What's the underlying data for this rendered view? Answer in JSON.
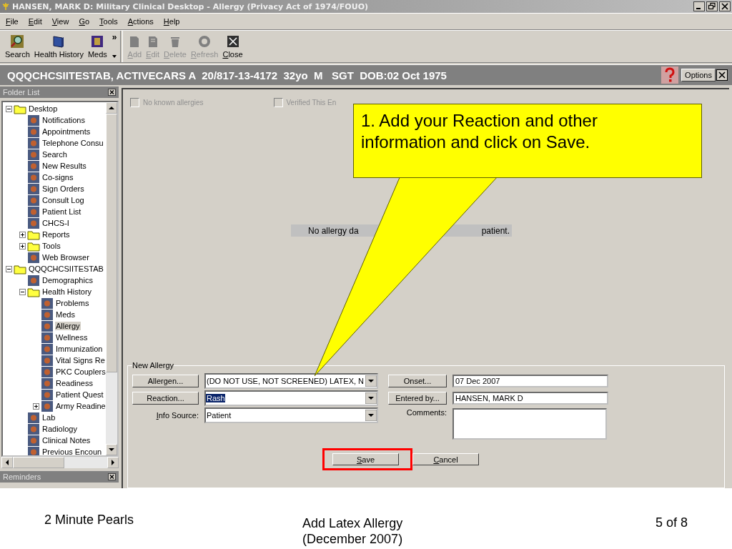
{
  "window": {
    "title": "HANSEN, MARK D: Military Clinical Desktop - Allergy (Privacy Act of 1974/FOUO)"
  },
  "menu": [
    "File",
    "Edit",
    "View",
    "Go",
    "Tools",
    "Actions",
    "Help"
  ],
  "toolbar": {
    "left": [
      {
        "label": "Search",
        "kind": "search",
        "disabled": false
      },
      {
        "label": "Health History",
        "kind": "book",
        "disabled": false
      },
      {
        "label": "Meds",
        "kind": "meds",
        "disabled": false
      }
    ],
    "more": "»",
    "right": [
      {
        "label": "Add",
        "kind": "doc",
        "disabled": true
      },
      {
        "label": "Edit",
        "kind": "edit",
        "disabled": true
      },
      {
        "label": "Delete",
        "kind": "trash",
        "disabled": true
      },
      {
        "label": "Refresh",
        "kind": "refresh",
        "disabled": true
      },
      {
        "label": "Close",
        "kind": "close",
        "disabled": false
      }
    ]
  },
  "patient_bar": {
    "text": "QQQCHCSIITESTAB, ACTIVECARS A  20/817-13-4172  32yo  M   SGT  DOB:02 Oct 1975",
    "options": "Options"
  },
  "folder_list": {
    "title": "Folder List",
    "tree": [
      {
        "label": "Desktop",
        "kind": "folder",
        "selected": false,
        "expanded": true,
        "children": [
          {
            "label": "Notifications",
            "kind": "module",
            "selected": false
          },
          {
            "label": "Appointments",
            "kind": "module",
            "selected": false
          },
          {
            "label": "Telephone Consu",
            "kind": "module",
            "selected": false
          },
          {
            "label": "Search",
            "kind": "module",
            "selected": false
          },
          {
            "label": "New Results",
            "kind": "module",
            "selected": false
          },
          {
            "label": "Co-signs",
            "kind": "module",
            "selected": false
          },
          {
            "label": "Sign Orders",
            "kind": "module",
            "selected": false
          },
          {
            "label": "Consult Log",
            "kind": "module",
            "selected": false
          },
          {
            "label": "Patient List",
            "kind": "module",
            "selected": false
          },
          {
            "label": "CHCS-I",
            "kind": "module",
            "selected": false
          },
          {
            "label": "Reports",
            "kind": "folder",
            "selected": false,
            "expanded": false
          },
          {
            "label": "Tools",
            "kind": "folder",
            "selected": false,
            "expanded": false
          },
          {
            "label": "Web Browser",
            "kind": "module",
            "selected": false
          }
        ]
      },
      {
        "label": "QQQCHCSIITESTAB",
        "kind": "folder",
        "selected": false,
        "expanded": true,
        "children": [
          {
            "label": "Demographics",
            "kind": "module",
            "selected": false
          },
          {
            "label": "Health History",
            "kind": "folder",
            "selected": false,
            "expanded": true,
            "children": [
              {
                "label": "Problems",
                "kind": "module",
                "selected": false
              },
              {
                "label": "Meds",
                "kind": "module",
                "selected": false
              },
              {
                "label": "Allergy",
                "kind": "module",
                "selected": true
              },
              {
                "label": "Wellness",
                "kind": "module",
                "selected": false
              },
              {
                "label": "Immunization",
                "kind": "module",
                "selected": false
              },
              {
                "label": "Vital Signs Re",
                "kind": "module",
                "selected": false
              },
              {
                "label": "PKC Couplers",
                "kind": "module",
                "selected": false
              },
              {
                "label": "Readiness",
                "kind": "module",
                "selected": false
              },
              {
                "label": "Patient Quest",
                "kind": "module",
                "selected": false
              },
              {
                "label": "Army Readine",
                "kind": "module",
                "selected": false,
                "expanded": false
              }
            ]
          },
          {
            "label": "Lab",
            "kind": "module",
            "selected": false
          },
          {
            "label": "Radiology",
            "kind": "module",
            "selected": false
          },
          {
            "label": "Clinical Notes",
            "kind": "module",
            "selected": false
          },
          {
            "label": "Previous Encoun",
            "kind": "module",
            "selected": false
          }
        ]
      }
    ]
  },
  "reminders": {
    "title": "Reminders"
  },
  "allergy": {
    "no_known": {
      "label": "No known allergies",
      "checked": false,
      "disabled": true
    },
    "verified": {
      "label": "Verified This En",
      "checked": false,
      "disabled": true
    },
    "message": [
      "No allergy da",
      "patient."
    ],
    "group_title": "New Allergy",
    "allergen": {
      "button": "Allergen...",
      "value": "(DO NOT USE, NOT SCREENED) LATEX, N"
    },
    "reaction": {
      "button": "Reaction...",
      "value": "Rash",
      "highlighted": true
    },
    "info_source": {
      "label": "Info Source:",
      "value": "Patient"
    },
    "onset": {
      "button": "Onset...",
      "value": "07 Dec 2007"
    },
    "entered_by": {
      "button": "Entered by...",
      "value": "HANSEN, MARK D"
    },
    "comments": {
      "label": "Comments:"
    },
    "save": "Save",
    "cancel": "Cancel"
  },
  "callout": {
    "text": "1.  Add your Reaction  and other information and click on Save."
  },
  "footer": {
    "left": "2 Minute Pearls",
    "center": [
      "Add Latex Allergy",
      "(December 2007)"
    ],
    "right": "5 of 8"
  }
}
